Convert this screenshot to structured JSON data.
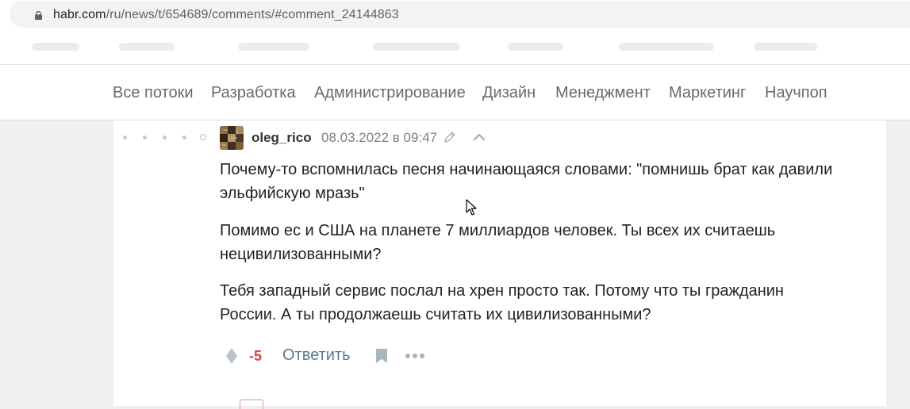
{
  "browser": {
    "url_host": "habr.com",
    "url_path": "/ru/news/t/654689/comments/#comment_24144863"
  },
  "nav": {
    "items": [
      "Все потоки",
      "Разработка",
      "Администрирование",
      "Дизайн",
      "Менеджмент",
      "Маркетинг",
      "Научпоп"
    ]
  },
  "comment": {
    "author": "oleg_rico",
    "date": "08.03.2022 в 09:47",
    "paragraphs": [
      [
        "Почему-то вспомнилась песня начинающаяся словами: \"помнишь брат как давили",
        "эльфийскую мразь\""
      ],
      [
        "Помимо ес и США на планете 7 миллиардов человек. Ты всех их считаешь",
        "нецивилизованными?"
      ],
      [
        "Тебя западный сервис послал на хрен просто так. Потому что ты гражданин",
        "России. А ты продолжаешь считать их цивилизованными?"
      ]
    ],
    "score": "-5",
    "reply_label": "Ответить"
  },
  "icons": {
    "lock": "lock-icon",
    "edit": "pencil-icon",
    "collapse": "chevron-up-icon",
    "vote": "vote-diamond-icon",
    "bookmark": "bookmark-icon",
    "more": "more-dots-icon"
  },
  "colors": {
    "score_negative": "#d04545",
    "reply_link": "#5a7a92",
    "nav_text": "#6a6a6a"
  }
}
